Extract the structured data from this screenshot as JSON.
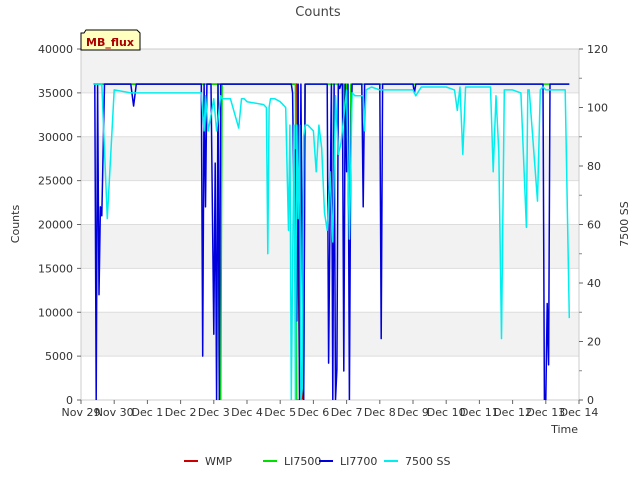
{
  "chart_data": {
    "type": "line",
    "title": "Counts",
    "xlabel": "Time",
    "ylabel": "Counts",
    "y2label": "7500 SS",
    "ylim": [
      0,
      40000
    ],
    "y2lim": [
      0,
      120
    ],
    "xlim": [
      "2023-11-29",
      "2023-12-14"
    ],
    "y_ticks": [
      "0",
      "5000",
      "10000",
      "15000",
      "20000",
      "25000",
      "30000",
      "35000",
      "40000"
    ],
    "y2_ticks": [
      "0",
      "20",
      "40",
      "60",
      "80",
      "100",
      "120"
    ],
    "x_ticks": [
      "Nov 29",
      "Nov 30",
      "Dec 1",
      "Dec 2",
      "Dec 3",
      "Dec 4",
      "Dec 5",
      "Dec 6",
      "Dec 7",
      "Dec 8",
      "Dec 9",
      "Dec 10",
      "Dec 11",
      "Dec 12",
      "Dec 13",
      "Dec 14"
    ],
    "x_tick_values": [
      "2023-11-29",
      "2023-11-30",
      "2023-12-01",
      "2023-12-02",
      "2023-12-03",
      "2023-12-04",
      "2023-12-05",
      "2023-12-06",
      "2023-12-07",
      "2023-12-08",
      "2023-12-09",
      "2023-12-10",
      "2023-12-11",
      "2023-12-12",
      "2023-12-13",
      "2023-12-14"
    ],
    "annotation": "MB_flux",
    "grid": "horizontal bands",
    "legend_placement": "bottom-center",
    "series": [
      {
        "name": "WMP",
        "axis": "left",
        "color": "#cc0000",
        "x": [
          "2023-11-29 09:00",
          "2023-12-05 12:00",
          "2023-12-05 14:00",
          "2023-12-05 16:00",
          "2023-12-05 18:00"
        ],
        "y": [
          36000,
          36000,
          0,
          0,
          36000
        ]
      },
      {
        "name": "LI7500",
        "axis": "left",
        "color": "#00e000",
        "x": [
          "2023-11-29 09:00",
          "2023-12-03 03:00",
          "2023-12-03 04:00",
          "2023-12-03 05:00",
          "2023-12-03 06:00",
          "2023-12-03 07:00",
          "2023-12-05 11:00",
          "2023-12-05 12:00",
          "2023-12-05 13:00",
          "2023-12-05 15:00",
          "2023-12-05 17:00",
          "2023-12-05 18:00",
          "2023-12-06 22:00",
          "2023-12-06 23:00",
          "2023-12-07 00:00",
          "2023-12-07 02:00",
          "2023-12-07 03:00",
          "2023-12-13 17:00"
        ],
        "y": [
          36000,
          36000,
          0,
          0,
          36000,
          36000,
          36000,
          0,
          0,
          0,
          0,
          36000,
          36000,
          30000,
          36000,
          17000,
          36000,
          36000
        ]
      },
      {
        "name": "LI7700",
        "axis": "left",
        "color": "#0000dd",
        "x": [
          "2023-11-29 09:00",
          "2023-11-29 10:00",
          "2023-11-29 11:00",
          "2023-11-29 12:00",
          "2023-11-29 13:00",
          "2023-11-29 14:00",
          "2023-11-29 15:00",
          "2023-11-29 17:00",
          "2023-11-29 19:00",
          "2023-11-30 12:00",
          "2023-11-30 14:00",
          "2023-11-30 16:00",
          "2023-12-02 15:00",
          "2023-12-02 16:00",
          "2023-12-02 17:00",
          "2023-12-02 18:00",
          "2023-12-02 19:00",
          "2023-12-02 22:00",
          "2023-12-03 00:00",
          "2023-12-03 01:00",
          "2023-12-03 02:00",
          "2023-12-03 03:00",
          "2023-12-03 04:00",
          "2023-12-03 05:00",
          "2023-12-03 06:00",
          "2023-12-05 08:00",
          "2023-12-05 09:00",
          "2023-12-05 10:00",
          "2023-12-05 11:00",
          "2023-12-05 12:00",
          "2023-12-05 13:00",
          "2023-12-05 14:00",
          "2023-12-05 15:00",
          "2023-12-05 16:00",
          "2023-12-05 17:00",
          "2023-12-05 18:00",
          "2023-12-05 19:00",
          "2023-12-05 20:00",
          "2023-12-06 10:00",
          "2023-12-06 11:00",
          "2023-12-06 12:00",
          "2023-12-06 13:00",
          "2023-12-06 14:00",
          "2023-12-06 15:00",
          "2023-12-06 16:00",
          "2023-12-06 17:00",
          "2023-12-06 18:00",
          "2023-12-06 19:00",
          "2023-12-06 20:00",
          "2023-12-06 21:00",
          "2023-12-06 22:00",
          "2023-12-06 23:00",
          "2023-12-07 00:00",
          "2023-12-07 01:00",
          "2023-12-07 02:00",
          "2023-12-07 03:00",
          "2023-12-07 04:00",
          "2023-12-07 05:00",
          "2023-12-07 10:00",
          "2023-12-07 11:00",
          "2023-12-07 12:00",
          "2023-12-07 13:00",
          "2023-12-07 14:00",
          "2023-12-07 22:00",
          "2023-12-08 00:00",
          "2023-12-08 01:00",
          "2023-12-08 02:00",
          "2023-12-08 03:00",
          "2023-12-09 00:00",
          "2023-12-09 01:00",
          "2023-12-09 02:00",
          "2023-12-12 20:00",
          "2023-12-12 21:00",
          "2023-12-12 22:00",
          "2023-12-12 23:00",
          "2023-12-13 00:00",
          "2023-12-13 01:00",
          "2023-12-13 02:00",
          "2023-12-13 03:00",
          "2023-12-13 04:00",
          "2023-12-13 05:00",
          "2023-12-13 17:00"
        ],
        "y": [
          36000,
          36000,
          0,
          36000,
          12000,
          22000,
          21000,
          36000,
          36000,
          36000,
          33500,
          36000,
          36000,
          5000,
          36000,
          22000,
          36000,
          36000,
          7500,
          27000,
          0,
          36000,
          0,
          36000,
          36000,
          36000,
          35000,
          22000,
          28500,
          9000,
          36000,
          0,
          36000,
          15000,
          0,
          36000,
          36000,
          36000,
          36000,
          4200,
          20500,
          36000,
          0,
          36000,
          0,
          3500,
          36000,
          35500,
          36000,
          36000,
          3300,
          36000,
          26000,
          36000,
          0,
          29000,
          36000,
          36000,
          36000,
          36000,
          22000,
          36000,
          36000,
          36000,
          36000,
          7000,
          36000,
          36000,
          36000,
          35000,
          36000,
          36000,
          36000,
          36000,
          0,
          0,
          11000,
          4000,
          36000,
          36000,
          36000,
          36000
        ]
      },
      {
        "name": "7500 SS",
        "axis": "right",
        "color": "#00eeee",
        "x": [
          "2023-11-29 09:00",
          "2023-11-29 15:00",
          "2023-11-29 19:00",
          "2023-11-30 00:00",
          "2023-11-30 12:00",
          "2023-12-01 00:00",
          "2023-12-02 00:00",
          "2023-12-02 15:00",
          "2023-12-02 17:00",
          "2023-12-02 18:00",
          "2023-12-02 20:00",
          "2023-12-03 00:00",
          "2023-12-03 02:00",
          "2023-12-03 05:00",
          "2023-12-03 06:00",
          "2023-12-03 08:00",
          "2023-12-03 12:00",
          "2023-12-03 18:00",
          "2023-12-03 20:00",
          "2023-12-03 22:00",
          "2023-12-04 00:00",
          "2023-12-04 12:00",
          "2023-12-04 14:00",
          "2023-12-04 15:00",
          "2023-12-04 16:00",
          "2023-12-04 17:00",
          "2023-12-04 20:00",
          "2023-12-05 00:00",
          "2023-12-05 04:00",
          "2023-12-05 06:00",
          "2023-12-05 07:00",
          "2023-12-05 08:00",
          "2023-12-05 10:00",
          "2023-12-05 11:00",
          "2023-12-05 12:00",
          "2023-12-05 13:00",
          "2023-12-05 14:00",
          "2023-12-05 15:00",
          "2023-12-05 16:00",
          "2023-12-05 17:00",
          "2023-12-05 18:00",
          "2023-12-05 20:00",
          "2023-12-06 00:00",
          "2023-12-06 02:00",
          "2023-12-06 04:00",
          "2023-12-06 06:00",
          "2023-12-06 08:00",
          "2023-12-06 10:00",
          "2023-12-06 12:00",
          "2023-12-06 14:00",
          "2023-12-06 16:00",
          "2023-12-06 18:00",
          "2023-12-06 20:00",
          "2023-12-07 00:00",
          "2023-12-07 02:00",
          "2023-12-07 04:00",
          "2023-12-07 06:00",
          "2023-12-07 12:00",
          "2023-12-07 13:00",
          "2023-12-07 14:00",
          "2023-12-07 18:00",
          "2023-12-08 00:00",
          "2023-12-09 00:00",
          "2023-12-09 02:00",
          "2023-12-09 06:00",
          "2023-12-10 00:00",
          "2023-12-10 06:00",
          "2023-12-10 08:00",
          "2023-12-10 10:00",
          "2023-12-10 12:00",
          "2023-12-10 14:00",
          "2023-12-10 18:00",
          "2023-12-11 06:00",
          "2023-12-11 08:00",
          "2023-12-11 10:00",
          "2023-12-11 12:00",
          "2023-12-11 14:00",
          "2023-12-11 16:00",
          "2023-12-11 18:00",
          "2023-12-11 20:00",
          "2023-12-12 00:00",
          "2023-12-12 06:00",
          "2023-12-12 10:00",
          "2023-12-12 11:00",
          "2023-12-12 12:00",
          "2023-12-12 18:00",
          "2023-12-12 20:00",
          "2023-12-12 22:00",
          "2023-12-13 00:00",
          "2023-12-13 06:00",
          "2023-12-13 12:00",
          "2023-12-13 14:00",
          "2023-12-13 17:00"
        ],
        "y": [
          108,
          108,
          62,
          106,
          105,
          105,
          105,
          105,
          92,
          104,
          92,
          103,
          92,
          104,
          103,
          103,
          103,
          93,
          103,
          103,
          102,
          101,
          100,
          50,
          100,
          103,
          103,
          102,
          100,
          58,
          94,
          0,
          94,
          0,
          94,
          62,
          94,
          0,
          4,
          90,
          94,
          94,
          92,
          78,
          94,
          86,
          64,
          58,
          78,
          54,
          104,
          84,
          88,
          106,
          55,
          105,
          104,
          104,
          92,
          106,
          107,
          106,
          106,
          104,
          107,
          107,
          106,
          99,
          107,
          84,
          107,
          107,
          107,
          107,
          78,
          104,
          85,
          21,
          106,
          106,
          106,
          105,
          59,
          106,
          106,
          68,
          106,
          107,
          106,
          106,
          106,
          106,
          28
        ]
      }
    ]
  }
}
